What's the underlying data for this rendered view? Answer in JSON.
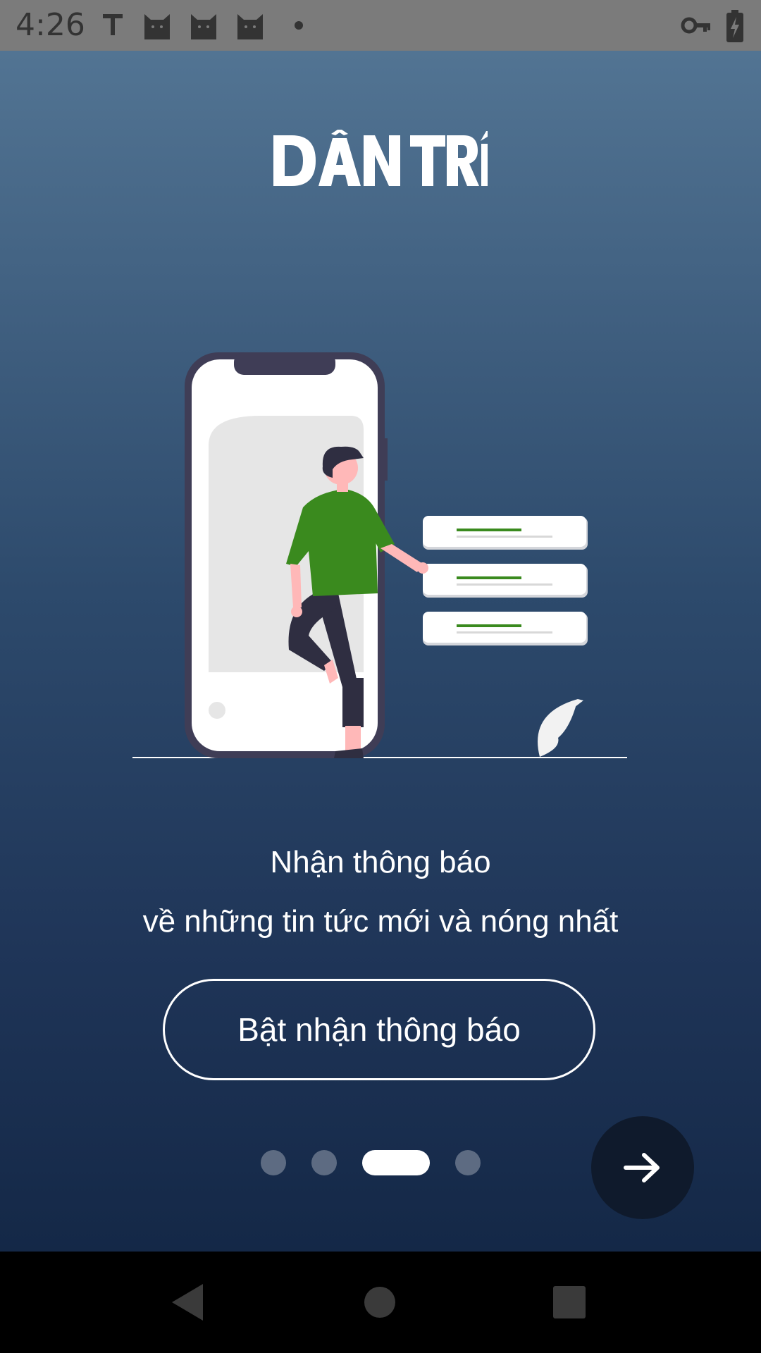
{
  "status_bar": {
    "time": "4:26",
    "left_icons": [
      "text-t-icon",
      "cat-icon",
      "cat-icon",
      "cat-icon",
      "dot-icon"
    ],
    "right_icons": [
      "key-icon",
      "battery-charging-icon"
    ]
  },
  "app": {
    "logo_text": "DÂN TRÍ",
    "illustration": "notification-phone-person-illustration",
    "headline_line1": "Nhận thông báo",
    "headline_line2": "về những tin tức mới và nóng nhất",
    "enable_button_label": "Bật nhận thông báo",
    "pager": {
      "count": 4,
      "active_index": 2
    },
    "next_button_icon": "arrow-right-icon"
  },
  "nav_bar": {
    "buttons": [
      "back-icon",
      "home-icon",
      "recents-icon"
    ]
  },
  "colors": {
    "status_bar": "#7b7b7b",
    "gradient_top": "#527493",
    "gradient_bottom": "#142847",
    "accent_green": "#3a8a1e",
    "next_button": "#0f1a2c"
  }
}
